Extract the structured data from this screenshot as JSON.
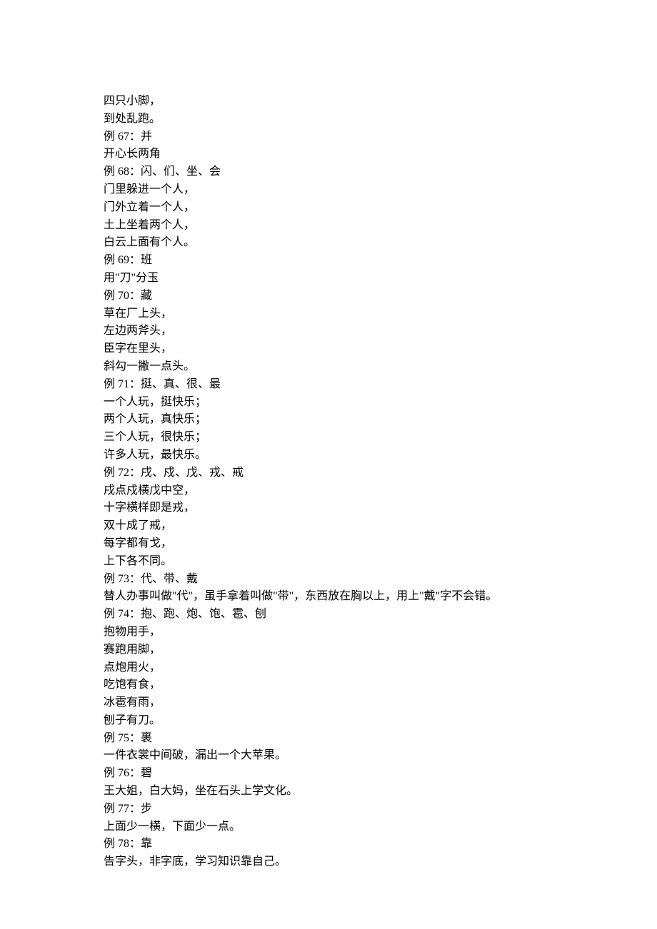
{
  "lines": [
    "四只小脚，",
    "到处乱跑。",
    "例 67：并",
    "开心长两角",
    "例 68：闪、们、坐、会",
    "门里躲进一个人，",
    "门外立着一个人，",
    "土上坐着两个人，",
    "白云上面有个人。",
    "例 69：班",
    "用\"刀\"分玉",
    "例 70：藏",
    "草在厂上头，",
    "左边两斧头，",
    "臣字在里头，",
    "斜勾一撇一点头。",
    "例 71：挺、真、很、最",
    "一个人玩，挺快乐；",
    "两个人玩，真快乐；",
    "三个人玩，很快乐；",
    "许多人玩，最快乐。",
    "例 72：戌、戍、戊、戎、戒",
    "戌点戍横戊中空，",
    "十字横样即是戎，",
    "双十成了戒，",
    "每字都有戈，",
    "上下各不同。",
    "例 73：代、带、戴",
    "替人办事叫做\"代\"，虽手拿着叫做\"带\"，东西放在胸以上，用上\"戴\"字不会错。",
    "例 74：抱、跑、炮、饱、雹、刨",
    "抱物用手，",
    "赛跑用脚，",
    "点炮用火，",
    "吃饱有食，",
    "冰雹有雨，",
    "刨子有刀。",
    "例 75：裹",
    "一件衣裳中间破，漏出一个大苹果。",
    "例 76：碧",
    "王大姐，白大妈，坐在石头上学文化。",
    "例 77：步",
    "上面少一横，下面少一点。",
    "例 78：靠",
    "告字头，非字底，学习知识靠自己。"
  ]
}
